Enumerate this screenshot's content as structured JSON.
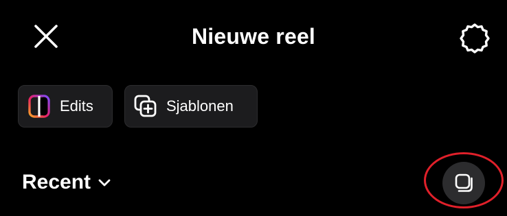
{
  "header": {
    "title": "Nieuwe reel",
    "close_icon": "close-icon",
    "settings_icon": "gear-icon"
  },
  "chips": [
    {
      "label": "Edits",
      "icon": "edits-app-icon"
    },
    {
      "label": "Sjablonen",
      "icon": "templates-icon"
    }
  ],
  "album": {
    "label": "Recent",
    "icon": "chevron-down-icon"
  },
  "multi_select": {
    "icon": "multi-select-icon"
  },
  "colors": {
    "background": "#000000",
    "chip_background": "#1c1c1e",
    "circle_button": "#2c2c2e",
    "annotation_ring": "#e0202a",
    "text": "#ffffff"
  }
}
